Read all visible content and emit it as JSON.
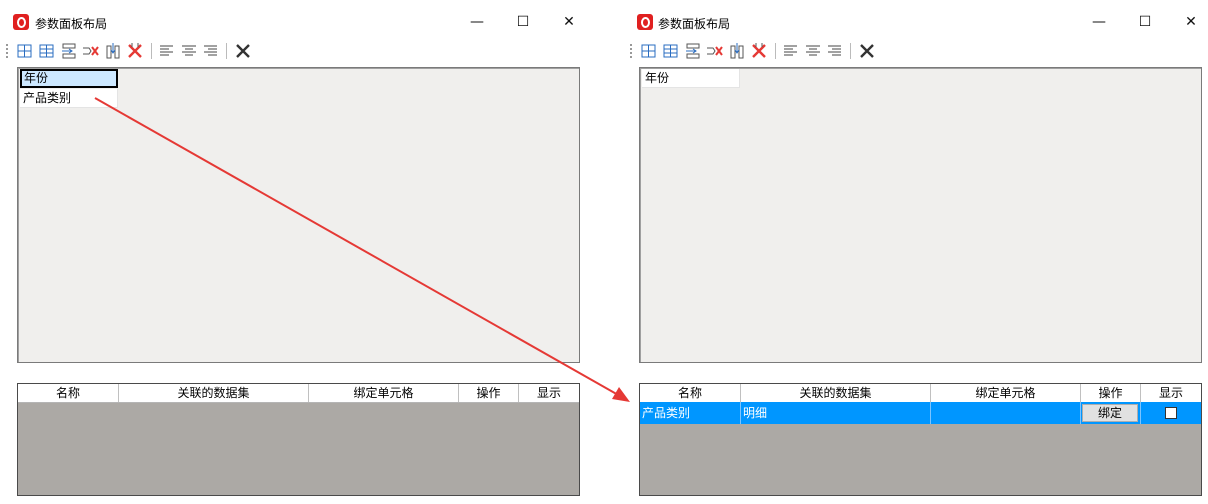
{
  "left_window": {
    "title": "参数面板布局",
    "controls": {
      "minimize": "—",
      "maximize": "☐",
      "close": "✕"
    },
    "params": [
      "年份",
      "产品类别"
    ],
    "columns": [
      "名称",
      "关联的数据集",
      "绑定单元格",
      "操作",
      "显示"
    ]
  },
  "right_window": {
    "title": "参数面板布局",
    "controls": {
      "minimize": "—",
      "maximize": "☐",
      "close": "✕"
    },
    "params": [
      "年份"
    ],
    "columns": [
      "名称",
      "关联的数据集",
      "绑定单元格",
      "操作",
      "显示"
    ],
    "row": {
      "name": "产品类别",
      "dataset": "明细",
      "cell": "",
      "action": "绑定",
      "visible": false
    }
  },
  "colors": {
    "accent_red": "#e53935",
    "row_selected": "#0096ff",
    "param_selected": "#cde8ff"
  },
  "toolbar_icons": [
    "insert-row-above-icon",
    "insert-row-below-icon",
    "insert-column-icon",
    "delete-row-icon",
    "insert-column-left-icon",
    "delete-column-icon",
    "align-left-icon",
    "align-center-icon",
    "align-right-icon",
    "clear-icon"
  ]
}
